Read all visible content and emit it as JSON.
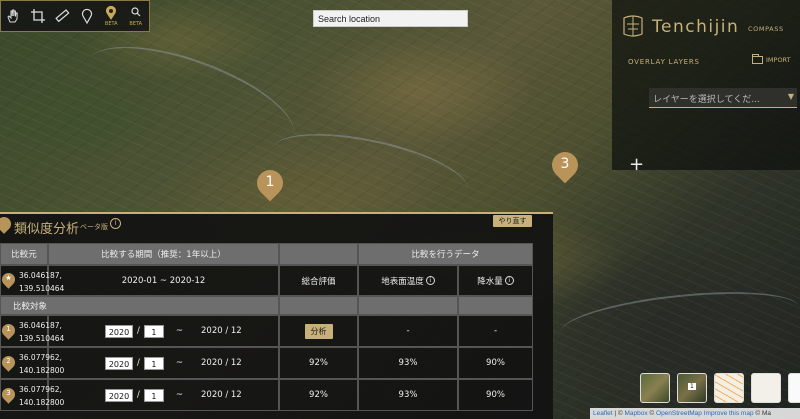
{
  "search": {
    "placeholder": "Search location"
  },
  "toolbar": {
    "tools": [
      {
        "name": "hand-icon"
      },
      {
        "name": "crop-icon"
      },
      {
        "name": "ruler-icon"
      },
      {
        "name": "pin-outline-icon"
      },
      {
        "name": "similarity-beta-icon",
        "badge": "BETA"
      },
      {
        "name": "search-beta-icon",
        "badge": "BETA"
      }
    ]
  },
  "brand": {
    "name": "Tenchijin",
    "sub": "COMPASS"
  },
  "overlay": {
    "label": "OVERLAY LAYERS",
    "import_label": "IMPORT",
    "select_placeholder": "レイヤーを選択してくだ...",
    "select_arrow": "▼"
  },
  "map": {
    "zoom_in": "+",
    "markers": [
      {
        "num": "1"
      },
      {
        "num": "3"
      }
    ]
  },
  "analysis": {
    "title": "類似度分析",
    "tag": "ベータ版",
    "info": "i",
    "redo": "やり直す",
    "headers": {
      "origin": "比較元",
      "period": "比較する期間（推奨：1年以上）",
      "data": "比較を行うデータ"
    },
    "origin_row": {
      "marker": "★",
      "coord_lat": "36.046187,",
      "coord_lon": "139.510464",
      "period": "2020-01 ~ 2020-12",
      "overall_label": "総合評価",
      "temp_label": "地表面温度",
      "rain_label": "降水量"
    },
    "targets_label": "比較対象",
    "targets": [
      {
        "num": "1",
        "lat": "36.046187,",
        "lon": "139.510464",
        "year": "2020",
        "month": "1",
        "tilde": "~",
        "end": "2020 / 12",
        "overall": "分析",
        "temp": "-",
        "rain": "-"
      },
      {
        "num": "2",
        "lat": "36.077962,",
        "lon": "140.182800",
        "year": "2020",
        "month": "1",
        "tilde": "~",
        "end": "2020 / 12",
        "overall": "92%",
        "temp": "93%",
        "rain": "90%"
      },
      {
        "num": "3",
        "lat": "36.077962,",
        "lon": "140.182800",
        "year": "2020",
        "month": "1",
        "tilde": "~",
        "end": "2020 / 12",
        "overall": "92%",
        "temp": "93%",
        "rain": "90%"
      }
    ],
    "slash": "/"
  },
  "thumbnails": [
    {
      "name": "thumb-satellite"
    },
    {
      "name": "thumb-satellite-numbered",
      "badge": "1"
    },
    {
      "name": "thumb-streets"
    },
    {
      "name": "thumb-light"
    },
    {
      "name": "thumb-blank"
    }
  ],
  "attribution": {
    "leaflet": "Leaflet",
    "sep": "|",
    "copyright": "©",
    "mapbox": "Mapbox",
    "osm": "OpenStreetMap",
    "improve": "Improve this map",
    "copy_ma": "© Ma"
  },
  "colors": {
    "gold": "#c7b07a",
    "pin": "#b8945a"
  }
}
